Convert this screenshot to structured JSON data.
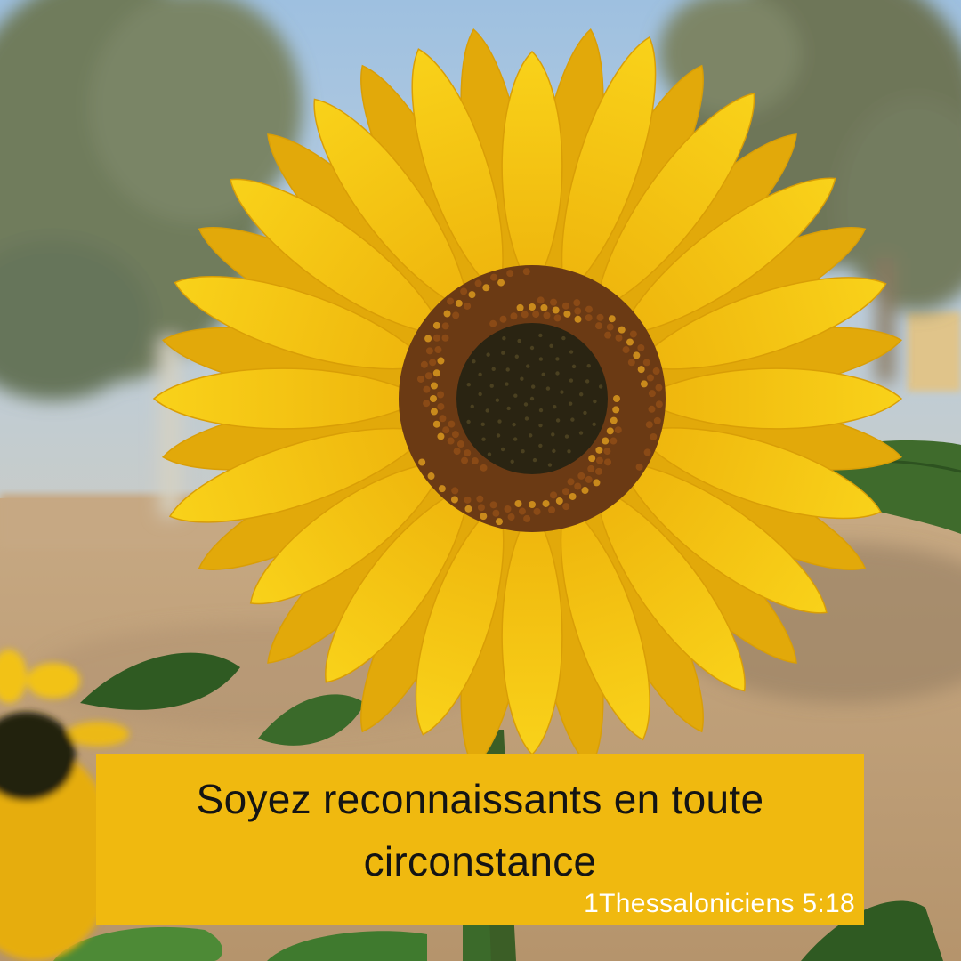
{
  "image": {
    "subject": "sunflower-photo",
    "colors": {
      "sky": "#8fb3d6",
      "ground": "#c2a27a",
      "petal": "#f7c60f",
      "petal_shade": "#e2a90a",
      "disc_outer": "#6b3a14",
      "disc_inner": "#2a2412",
      "leaf": "#3f6b2c",
      "foliage": "#6f7b55"
    }
  },
  "caption": {
    "line1": "Soyez reconnaissants en toute",
    "line2": "circonstance",
    "reference": "1Thessaloniciens 5:18",
    "box_color": "#f0b90f",
    "text_color": "#141414",
    "reference_color": "#ffffff"
  }
}
